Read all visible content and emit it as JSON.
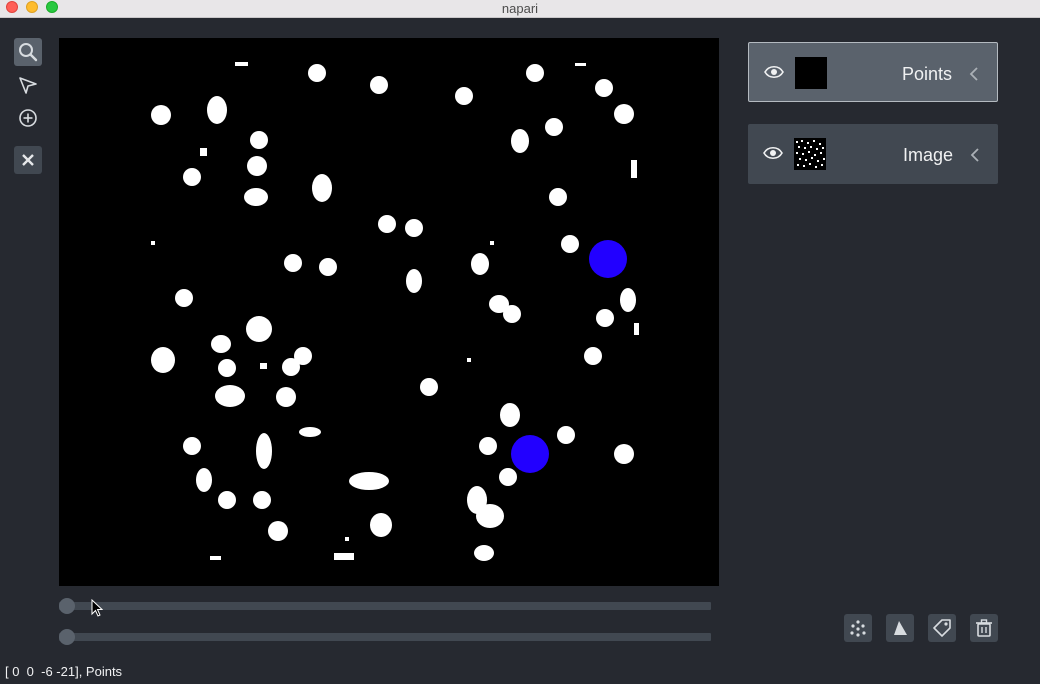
{
  "window": {
    "title": "napari"
  },
  "toolbar": {
    "tools": [
      {
        "name": "zoom-tool",
        "icon": "magnifier-icon",
        "active": true
      },
      {
        "name": "select-tool",
        "icon": "arrow-cursor-icon",
        "active": false
      },
      {
        "name": "add-point-tool",
        "icon": "circle-plus-icon",
        "active": false
      }
    ],
    "delete_icon": "x-icon"
  },
  "layers": [
    {
      "name": "Points",
      "visible": true,
      "selected": true
    },
    {
      "name": "Image",
      "visible": true,
      "selected": false
    }
  ],
  "dims": {
    "sliders": [
      {
        "value": 0
      },
      {
        "value": 0
      }
    ]
  },
  "layer_buttons": [
    {
      "icon": "new-points-icon"
    },
    {
      "icon": "new-shapes-icon"
    },
    {
      "icon": "new-labels-icon"
    },
    {
      "icon": "delete-layer-icon"
    }
  ],
  "status": {
    "text": "[ 0  0  -6 -21], Points"
  },
  "colors": {
    "background": "#262930",
    "panel": "#414851",
    "accent": "#5a626c",
    "point_face": "#2200ff"
  }
}
